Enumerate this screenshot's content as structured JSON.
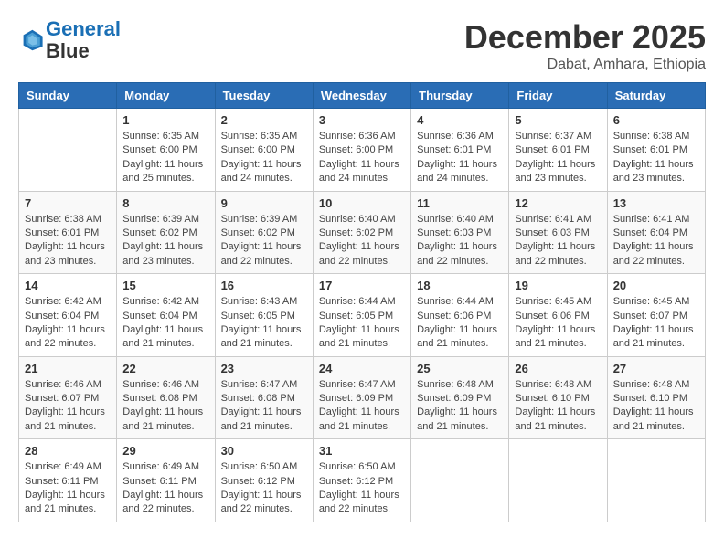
{
  "header": {
    "logo_line1": "General",
    "logo_line2": "Blue",
    "title": "December 2025",
    "subtitle": "Dabat, Amhara, Ethiopia"
  },
  "days_of_week": [
    "Sunday",
    "Monday",
    "Tuesday",
    "Wednesday",
    "Thursday",
    "Friday",
    "Saturday"
  ],
  "weeks": [
    [
      {
        "day": "",
        "text": ""
      },
      {
        "day": "1",
        "text": "Sunrise: 6:35 AM\nSunset: 6:00 PM\nDaylight: 11 hours\nand 25 minutes."
      },
      {
        "day": "2",
        "text": "Sunrise: 6:35 AM\nSunset: 6:00 PM\nDaylight: 11 hours\nand 24 minutes."
      },
      {
        "day": "3",
        "text": "Sunrise: 6:36 AM\nSunset: 6:00 PM\nDaylight: 11 hours\nand 24 minutes."
      },
      {
        "day": "4",
        "text": "Sunrise: 6:36 AM\nSunset: 6:01 PM\nDaylight: 11 hours\nand 24 minutes."
      },
      {
        "day": "5",
        "text": "Sunrise: 6:37 AM\nSunset: 6:01 PM\nDaylight: 11 hours\nand 23 minutes."
      },
      {
        "day": "6",
        "text": "Sunrise: 6:38 AM\nSunset: 6:01 PM\nDaylight: 11 hours\nand 23 minutes."
      }
    ],
    [
      {
        "day": "7",
        "text": "Sunrise: 6:38 AM\nSunset: 6:01 PM\nDaylight: 11 hours\nand 23 minutes."
      },
      {
        "day": "8",
        "text": "Sunrise: 6:39 AM\nSunset: 6:02 PM\nDaylight: 11 hours\nand 23 minutes."
      },
      {
        "day": "9",
        "text": "Sunrise: 6:39 AM\nSunset: 6:02 PM\nDaylight: 11 hours\nand 22 minutes."
      },
      {
        "day": "10",
        "text": "Sunrise: 6:40 AM\nSunset: 6:02 PM\nDaylight: 11 hours\nand 22 minutes."
      },
      {
        "day": "11",
        "text": "Sunrise: 6:40 AM\nSunset: 6:03 PM\nDaylight: 11 hours\nand 22 minutes."
      },
      {
        "day": "12",
        "text": "Sunrise: 6:41 AM\nSunset: 6:03 PM\nDaylight: 11 hours\nand 22 minutes."
      },
      {
        "day": "13",
        "text": "Sunrise: 6:41 AM\nSunset: 6:04 PM\nDaylight: 11 hours\nand 22 minutes."
      }
    ],
    [
      {
        "day": "14",
        "text": "Sunrise: 6:42 AM\nSunset: 6:04 PM\nDaylight: 11 hours\nand 22 minutes."
      },
      {
        "day": "15",
        "text": "Sunrise: 6:42 AM\nSunset: 6:04 PM\nDaylight: 11 hours\nand 21 minutes."
      },
      {
        "day": "16",
        "text": "Sunrise: 6:43 AM\nSunset: 6:05 PM\nDaylight: 11 hours\nand 21 minutes."
      },
      {
        "day": "17",
        "text": "Sunrise: 6:44 AM\nSunset: 6:05 PM\nDaylight: 11 hours\nand 21 minutes."
      },
      {
        "day": "18",
        "text": "Sunrise: 6:44 AM\nSunset: 6:06 PM\nDaylight: 11 hours\nand 21 minutes."
      },
      {
        "day": "19",
        "text": "Sunrise: 6:45 AM\nSunset: 6:06 PM\nDaylight: 11 hours\nand 21 minutes."
      },
      {
        "day": "20",
        "text": "Sunrise: 6:45 AM\nSunset: 6:07 PM\nDaylight: 11 hours\nand 21 minutes."
      }
    ],
    [
      {
        "day": "21",
        "text": "Sunrise: 6:46 AM\nSunset: 6:07 PM\nDaylight: 11 hours\nand 21 minutes."
      },
      {
        "day": "22",
        "text": "Sunrise: 6:46 AM\nSunset: 6:08 PM\nDaylight: 11 hours\nand 21 minutes."
      },
      {
        "day": "23",
        "text": "Sunrise: 6:47 AM\nSunset: 6:08 PM\nDaylight: 11 hours\nand 21 minutes."
      },
      {
        "day": "24",
        "text": "Sunrise: 6:47 AM\nSunset: 6:09 PM\nDaylight: 11 hours\nand 21 minutes."
      },
      {
        "day": "25",
        "text": "Sunrise: 6:48 AM\nSunset: 6:09 PM\nDaylight: 11 hours\nand 21 minutes."
      },
      {
        "day": "26",
        "text": "Sunrise: 6:48 AM\nSunset: 6:10 PM\nDaylight: 11 hours\nand 21 minutes."
      },
      {
        "day": "27",
        "text": "Sunrise: 6:48 AM\nSunset: 6:10 PM\nDaylight: 11 hours\nand 21 minutes."
      }
    ],
    [
      {
        "day": "28",
        "text": "Sunrise: 6:49 AM\nSunset: 6:11 PM\nDaylight: 11 hours\nand 21 minutes."
      },
      {
        "day": "29",
        "text": "Sunrise: 6:49 AM\nSunset: 6:11 PM\nDaylight: 11 hours\nand 22 minutes."
      },
      {
        "day": "30",
        "text": "Sunrise: 6:50 AM\nSunset: 6:12 PM\nDaylight: 11 hours\nand 22 minutes."
      },
      {
        "day": "31",
        "text": "Sunrise: 6:50 AM\nSunset: 6:12 PM\nDaylight: 11 hours\nand 22 minutes."
      },
      {
        "day": "",
        "text": ""
      },
      {
        "day": "",
        "text": ""
      },
      {
        "day": "",
        "text": ""
      }
    ]
  ]
}
